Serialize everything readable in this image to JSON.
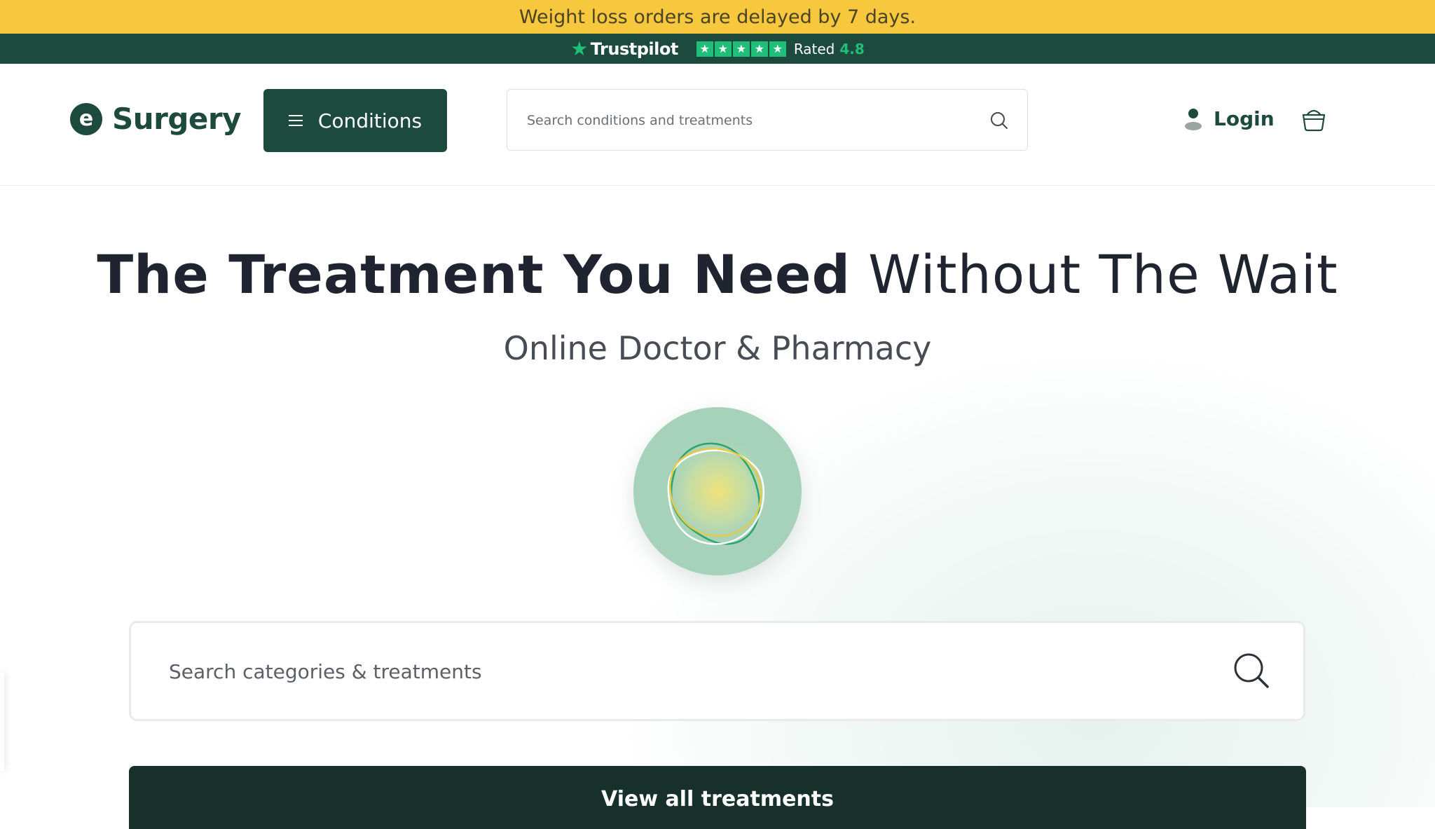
{
  "announcement": {
    "text": "Weight loss orders are delayed by 7 days."
  },
  "trustpilot": {
    "brand": "Trustpilot",
    "stars": [
      "★",
      "★",
      "★",
      "★",
      "★"
    ],
    "rated_label": "Rated",
    "rating": "4.8",
    "brand_color": "#1fbf7a"
  },
  "header": {
    "logo_mark": "e",
    "logo_text": "Surgery",
    "conditions_label": "Conditions",
    "search_placeholder": "Search conditions and treatments",
    "login_label": "Login",
    "icons": [
      "menu-icon",
      "search-icon",
      "user-icon",
      "basket-icon"
    ]
  },
  "hero": {
    "title_strong": "The Treatment You Need",
    "title_light": "Without The Wait",
    "subtitle": "Online Doctor & Pharmacy",
    "search_placeholder": "Search categories & treatments",
    "view_all_label": "View all treatments"
  },
  "colors": {
    "announcement_bg": "#f7c73e",
    "brand_dark": "#1c4a3c",
    "button_dark": "#17302a",
    "orb": "#a6d2bb"
  }
}
